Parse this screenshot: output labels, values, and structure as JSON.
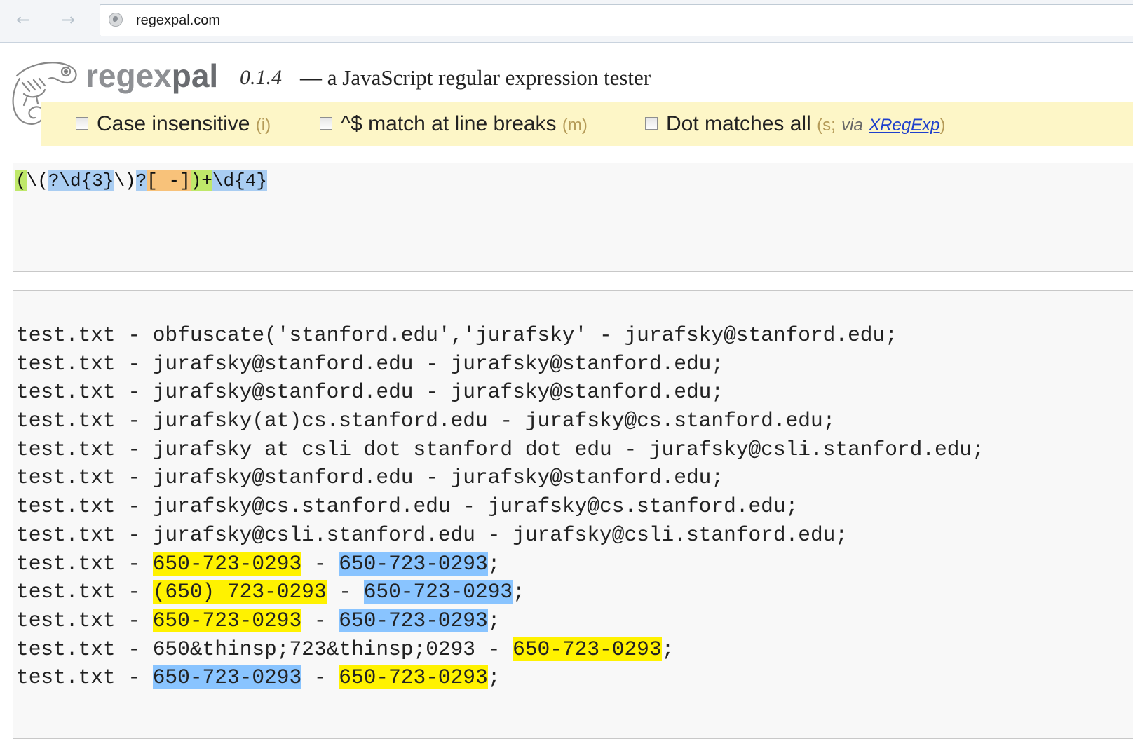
{
  "browser": {
    "back_icon": "arrow-left-icon",
    "forward_icon": "arrow-right-icon",
    "url": "regexpal.com"
  },
  "header": {
    "brand": "regexpal",
    "version": "0.1.4",
    "tagline": "— a JavaScript regular expression tester"
  },
  "flags": {
    "case_insensitive": {
      "label": "Case insensitive",
      "hint": "(i)",
      "checked": false
    },
    "multiline": {
      "label": "^$ match at line breaks",
      "hint": "(m)",
      "checked": false
    },
    "dotall": {
      "label": "Dot matches all",
      "hint_open": "(s;",
      "via": "via",
      "link": "XRegExp",
      "hint_close": ")",
      "checked": false
    }
  },
  "regex": {
    "tokens": [
      {
        "text": "(",
        "hl": "green"
      },
      {
        "text": "\\(",
        "hl": "none"
      },
      {
        "text": "?\\d{3}",
        "hl": "blue"
      },
      {
        "text": "\\)",
        "hl": "none"
      },
      {
        "text": "?",
        "hl": "blue"
      },
      {
        "text": "[ -]",
        "hl": "orange"
      },
      {
        "text": ")+",
        "hl": "green"
      },
      {
        "text": "\\d{4}",
        "hl": "blue"
      }
    ]
  },
  "test": {
    "lines": [
      [
        {
          "text": "test.txt - obfuscate('stanford.edu','jurafsky' - jurafsky@stanford.edu;",
          "hl": "none"
        }
      ],
      [
        {
          "text": "test.txt - jurafsky@stanford.edu - jurafsky@stanford.edu;",
          "hl": "none"
        }
      ],
      [
        {
          "text": "test.txt - jurafsky@stanford.edu - jurafsky@stanford.edu;",
          "hl": "none"
        }
      ],
      [
        {
          "text": "test.txt - jurafsky(at)cs.stanford.edu - jurafsky@cs.stanford.edu;",
          "hl": "none"
        }
      ],
      [
        {
          "text": "test.txt - jurafsky at csli dot stanford dot edu - jurafsky@csli.stanford.edu;",
          "hl": "none"
        }
      ],
      [
        {
          "text": "test.txt - jurafsky@stanford.edu - jurafsky@stanford.edu;",
          "hl": "none"
        }
      ],
      [
        {
          "text": "test.txt - jurafsky@cs.stanford.edu - jurafsky@cs.stanford.edu;",
          "hl": "none"
        }
      ],
      [
        {
          "text": "test.txt - jurafsky@csli.stanford.edu - jurafsky@csli.stanford.edu;",
          "hl": "none"
        }
      ],
      [
        {
          "text": "test.txt - ",
          "hl": "none"
        },
        {
          "text": "650-723-0293",
          "hl": "yellow"
        },
        {
          "text": " - ",
          "hl": "none"
        },
        {
          "text": "650-723-0293",
          "hl": "blue"
        },
        {
          "text": ";",
          "hl": "none"
        }
      ],
      [
        {
          "text": "test.txt - ",
          "hl": "none"
        },
        {
          "text": "(650) 723-0293",
          "hl": "yellow"
        },
        {
          "text": " - ",
          "hl": "none"
        },
        {
          "text": "650-723-0293",
          "hl": "blue"
        },
        {
          "text": ";",
          "hl": "none"
        }
      ],
      [
        {
          "text": "test.txt - ",
          "hl": "none"
        },
        {
          "text": "650-723-0293",
          "hl": "yellow"
        },
        {
          "text": " - ",
          "hl": "none"
        },
        {
          "text": "650-723-0293",
          "hl": "blue"
        },
        {
          "text": ";",
          "hl": "none"
        }
      ],
      [
        {
          "text": "test.txt - 650&thinsp;723&thinsp;0293 - ",
          "hl": "none"
        },
        {
          "text": "650-723-0293",
          "hl": "yellow"
        },
        {
          "text": ";",
          "hl": "none"
        }
      ],
      [
        {
          "text": "test.txt - ",
          "hl": "none"
        },
        {
          "text": "650-723-0293",
          "hl": "blue"
        },
        {
          "text": " - ",
          "hl": "none"
        },
        {
          "text": "650-723-0293",
          "hl": "yellow"
        },
        {
          "text": ";",
          "hl": "none"
        }
      ]
    ]
  }
}
